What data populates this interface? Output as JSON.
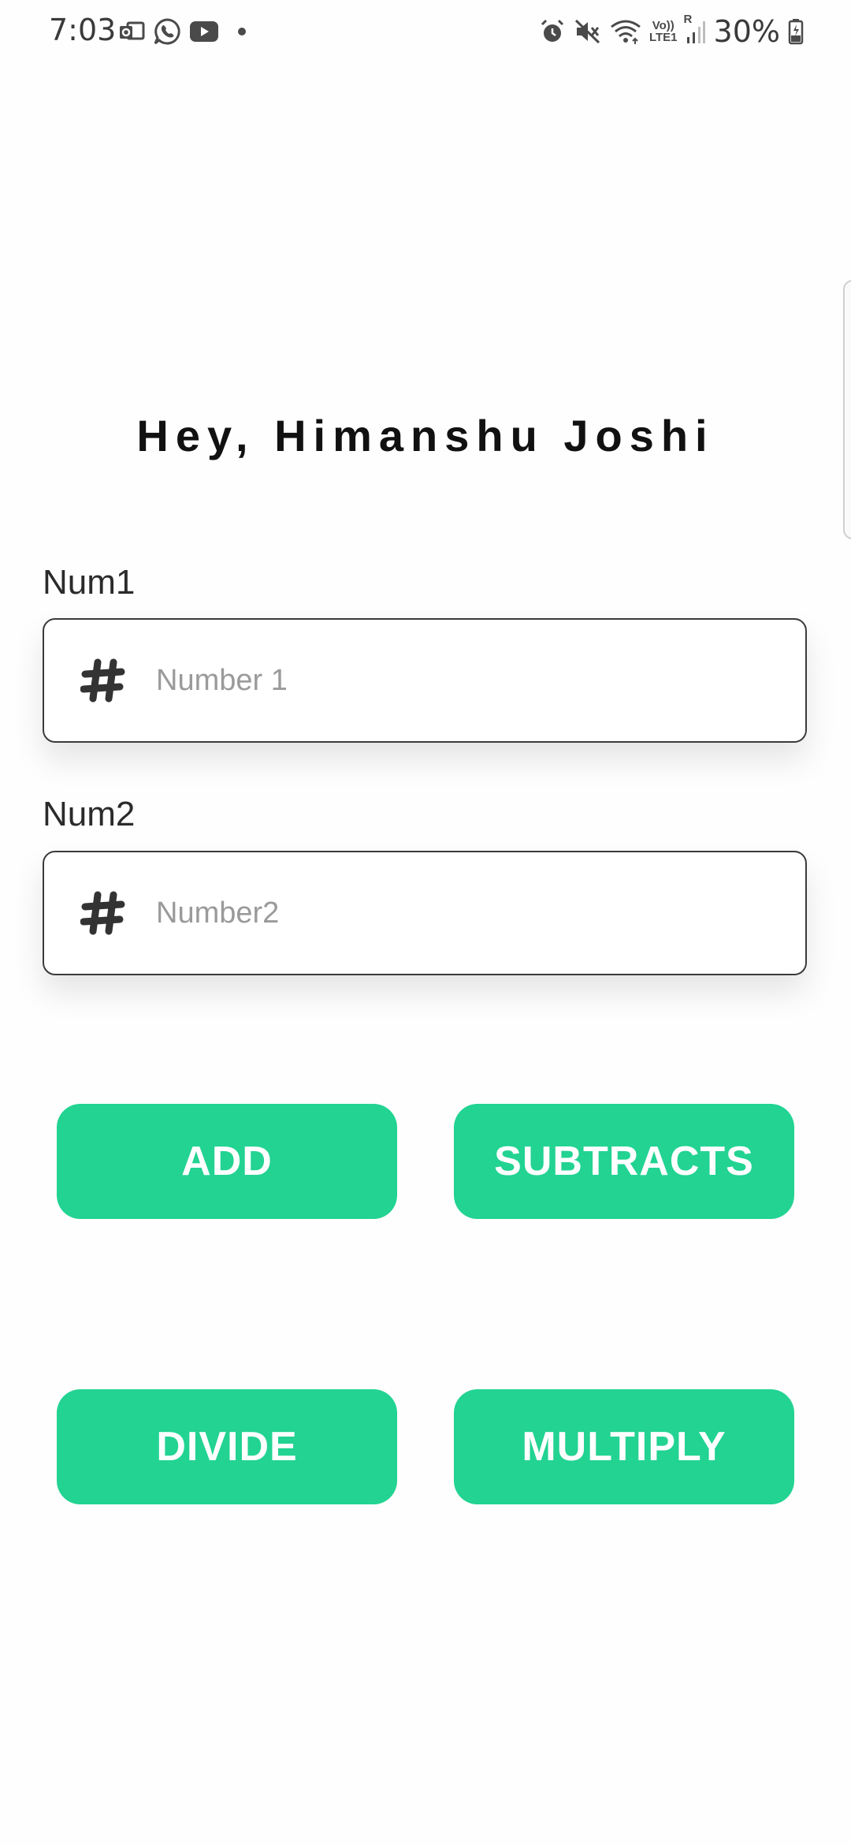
{
  "status_bar": {
    "time": "7:03",
    "left_icons": [
      "outlook-icon",
      "whatsapp-icon",
      "youtube-icon",
      "dot-icon"
    ],
    "right_icons": [
      "alarm-icon",
      "mute-icon",
      "wifi-icon",
      "volte-icon",
      "signal-icon",
      "battery-icon"
    ],
    "volte_top": "Vo))",
    "volte_bottom": "LTE1",
    "roaming": "R",
    "battery": "30%"
  },
  "greeting": "Hey, Himanshu Joshi",
  "fields": {
    "num1": {
      "label": "Num1",
      "placeholder": "Number 1",
      "value": "",
      "icon": "hash-icon"
    },
    "num2": {
      "label": "Num2",
      "placeholder": "Number2",
      "value": "",
      "icon": "hash-icon"
    }
  },
  "buttons": {
    "add": "ADD",
    "subtract": "SUBTRACTS",
    "divide": "DIVIDE",
    "multiply": "MULTIPLY"
  },
  "colors": {
    "accent": "#22d392",
    "button_text": "#ffffff",
    "field_border": "#3b3b3b",
    "placeholder": "#9a9a9a"
  }
}
